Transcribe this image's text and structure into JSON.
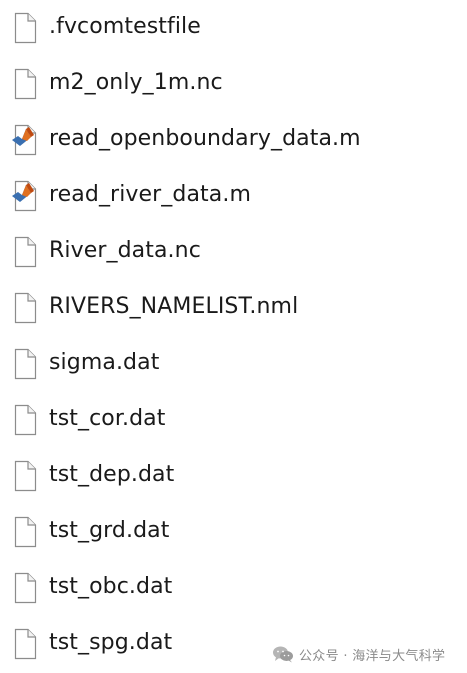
{
  "files": [
    {
      "name": ".fvcomtestfile",
      "icon": "blank-file-icon"
    },
    {
      "name": "m2_only_1m.nc",
      "icon": "blank-file-icon"
    },
    {
      "name": "read_openboundary_data.m",
      "icon": "matlab-file-icon"
    },
    {
      "name": "read_river_data.m",
      "icon": "matlab-file-icon"
    },
    {
      "name": "River_data.nc",
      "icon": "blank-file-icon"
    },
    {
      "name": "RIVERS_NAMELIST.nml",
      "icon": "blank-file-icon"
    },
    {
      "name": "sigma.dat",
      "icon": "blank-file-icon"
    },
    {
      "name": "tst_cor.dat",
      "icon": "blank-file-icon"
    },
    {
      "name": "tst_dep.dat",
      "icon": "blank-file-icon"
    },
    {
      "name": "tst_grd.dat",
      "icon": "blank-file-icon"
    },
    {
      "name": "tst_obc.dat",
      "icon": "blank-file-icon"
    },
    {
      "name": "tst_spg.dat",
      "icon": "blank-file-icon"
    }
  ],
  "watermark": {
    "icon": "wechat-icon",
    "text": "公众号 · 海洋与大气科学"
  },
  "colors": {
    "label_text": "#1a1a1a",
    "icon_outline": "#8c8c8c",
    "matlab_orange": "#e07020",
    "matlab_blue": "#3a6fb0"
  }
}
